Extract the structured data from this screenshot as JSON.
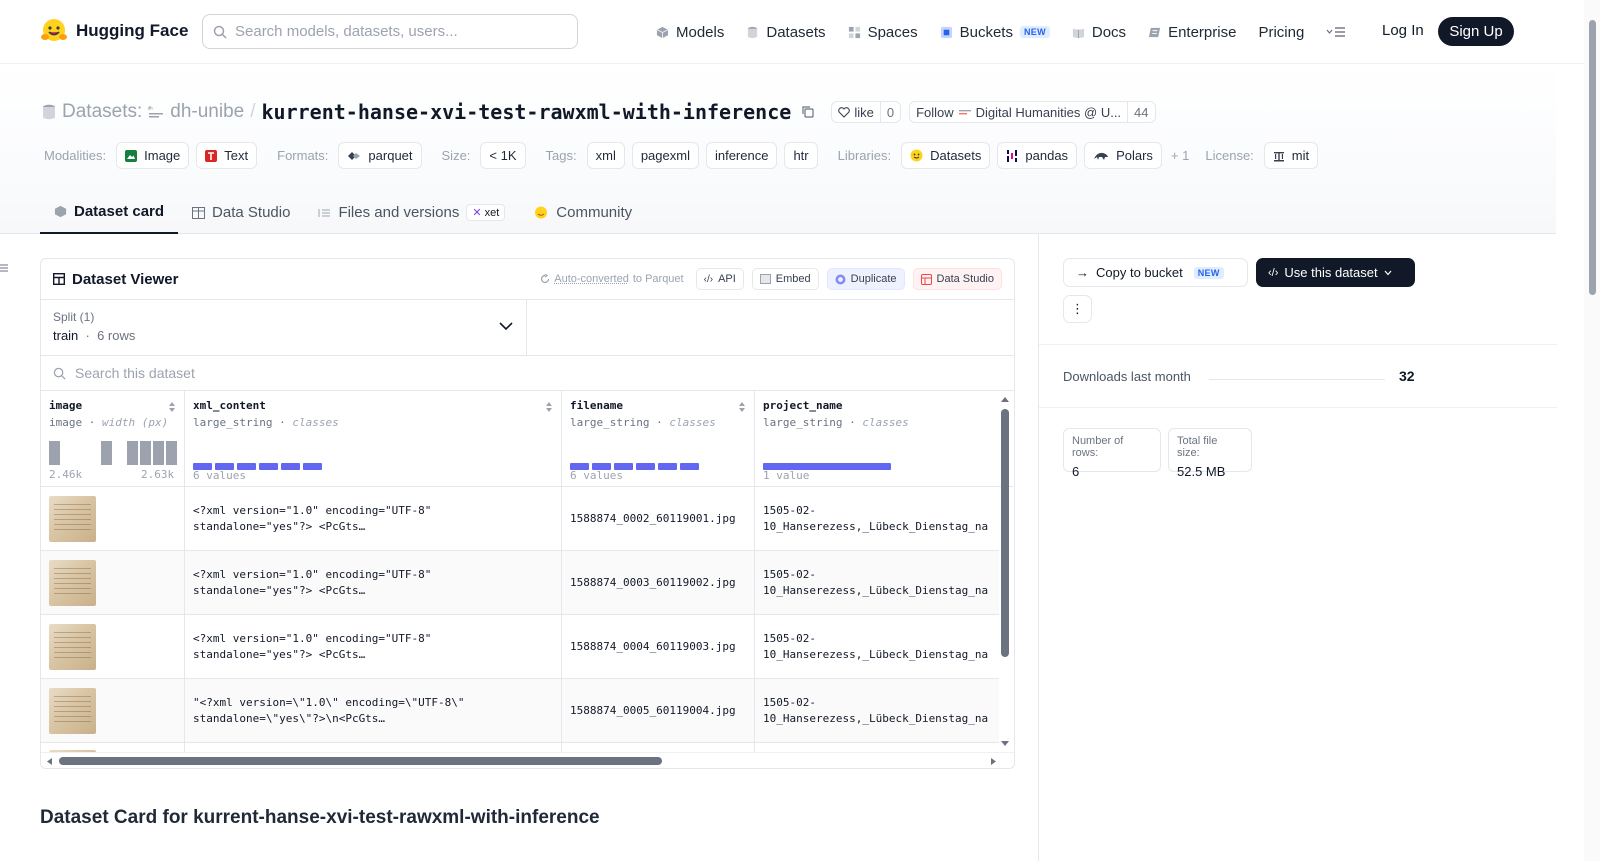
{
  "nav": {
    "brand": "Hugging Face",
    "search_placeholder": "Search models, datasets, users...",
    "items": [
      {
        "label": "Models",
        "icon": "cube-icon"
      },
      {
        "label": "Datasets",
        "icon": "database-icon"
      },
      {
        "label": "Spaces",
        "icon": "grid-icon"
      },
      {
        "label": "Buckets",
        "icon": "bucket-icon",
        "badge": "NEW"
      },
      {
        "label": "Docs",
        "icon": "book-icon"
      },
      {
        "label": "Enterprise",
        "icon": "enterprise-icon"
      },
      {
        "label": "Pricing"
      }
    ],
    "login": "Log In",
    "signup": "Sign Up"
  },
  "header": {
    "section": "Datasets:",
    "org": "dh-unibe",
    "slash": "/",
    "name": "kurrent-hanse-xvi-test-rawxml-with-inference",
    "like_label": "like",
    "like_count": "0",
    "follow_label": "Follow",
    "follow_org": "Digital Humanities @ U...",
    "follow_count": "44",
    "tags": {
      "modalities_label": "Modalities:",
      "modalities": [
        "Image",
        "Text"
      ],
      "formats_label": "Formats:",
      "formats": [
        "parquet"
      ],
      "size_label": "Size:",
      "size": "< 1K",
      "tags_label": "Tags:",
      "tags": [
        "xml",
        "pagexml",
        "inference",
        "htr"
      ],
      "libraries_label": "Libraries:",
      "libraries": [
        "Datasets",
        "pandas",
        "Polars"
      ],
      "libraries_more": "+ 1",
      "license_label": "License:",
      "license": "mit"
    },
    "tabs": [
      {
        "label": "Dataset card",
        "active": true
      },
      {
        "label": "Data Studio"
      },
      {
        "label": "Files and versions",
        "badge": "xet"
      },
      {
        "label": "Community"
      }
    ]
  },
  "viewer": {
    "title": "Dataset Viewer",
    "auto_converted": "Auto-converted",
    "auto_converted_suffix": " to Parquet",
    "buttons": [
      "API",
      "Embed",
      "Duplicate",
      "Data Studio"
    ],
    "split_label": "Split (1)",
    "split_value": "train",
    "split_rows": "6 rows",
    "search_placeholder": "Search this dataset",
    "columns": [
      {
        "name": "image",
        "type": "image",
        "meta": "width (px)",
        "min": "2.46k",
        "max": "2.63k"
      },
      {
        "name": "xml_content",
        "type": "large_string",
        "meta": "classes",
        "summary": "6 values"
      },
      {
        "name": "filename",
        "type": "large_string",
        "meta": "classes",
        "summary": "6 values"
      },
      {
        "name": "project_name",
        "type": "large_string",
        "meta": "classes",
        "summary": "1 value"
      }
    ],
    "rows": [
      {
        "xml": "<?xml version=\"1.0\" encoding=\"UTF-8\"\nstandalone=\"yes\"?> <PcGts…",
        "filename": "1588874_0002_60119001.jpg",
        "project": "1505-02-\n10_Hanserezess,_Lübeck_Dienstag_na"
      },
      {
        "xml": "<?xml version=\"1.0\" encoding=\"UTF-8\"\nstandalone=\"yes\"?> <PcGts…",
        "filename": "1588874_0003_60119002.jpg",
        "project": "1505-02-\n10_Hanserezess,_Lübeck_Dienstag_na"
      },
      {
        "xml": "<?xml version=\"1.0\" encoding=\"UTF-8\"\nstandalone=\"yes\"?> <PcGts…",
        "filename": "1588874_0004_60119003.jpg",
        "project": "1505-02-\n10_Hanserezess,_Lübeck_Dienstag_na"
      },
      {
        "xml": "\"<?xml version=\\\"1.0\\\" encoding=\\\"UTF-8\\\"\nstandalone=\\\"yes\\\"?>\\n<PcGts…",
        "filename": "1588874_0005_60119004.jpg",
        "project": "1505-02-\n10_Hanserezess,_Lübeck_Dienstag_na"
      }
    ]
  },
  "card_title": "Dataset Card for kurrent-hanse-xvi-test-rawxml-with-inference",
  "sidebar": {
    "copy_bucket": "Copy to bucket",
    "copy_badge": "NEW",
    "use_dataset": "Use this dataset",
    "more": "⋮",
    "downloads_label": "Downloads last month",
    "downloads_value": "32",
    "rows_label": "Number of rows:",
    "rows_value": "6",
    "size_label": "Total file size:",
    "size_value": "52.5 MB"
  },
  "colors": {
    "accent": "#6366f1",
    "dark": "#111827",
    "muted": "#9ca3af"
  }
}
